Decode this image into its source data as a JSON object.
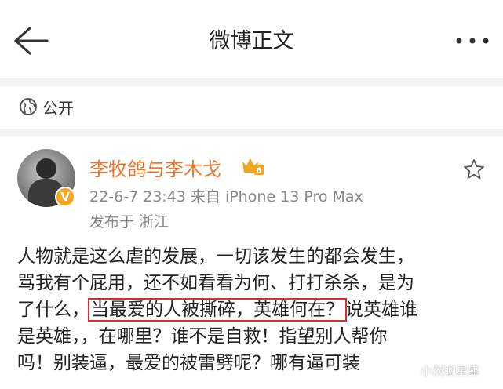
{
  "header": {
    "title": "微博正文",
    "back_icon": "back-arrow-icon",
    "more_icon": "more-dots-icon"
  },
  "visibility": {
    "icon": "globe-icon",
    "label": "公开"
  },
  "post": {
    "author": "李牧鸽与李木戈",
    "rank_badge": "6",
    "verified_badge": "V",
    "meta": "22-6-7 23:43  来自 iPhone 13 Pro Max",
    "location": "发布于 浙江",
    "favorite_icon": "star-icon",
    "content": {
      "line1": "人物就是这么虐的发展，一切该发生的都会发生，",
      "line2": "骂我有个屁用，还不如看看为何、打打杀杀，是为",
      "line3_pre": "了什么，",
      "line3_highlight": "当最爱的人被撕碎，英雄何在？",
      "line3_post": "说英雄谁",
      "line4": "是英雄，，在哪里？谁不是自救！指望别人帮你",
      "line5": "吗！别装逼，最爱的被雷劈呢？哪有逼可装"
    }
  },
  "watermark": "小茨聊星座",
  "colors": {
    "author": "#e8772e",
    "highlight_border": "#d82e2e",
    "meta": "#888888",
    "divider": "#f3f3f3"
  }
}
